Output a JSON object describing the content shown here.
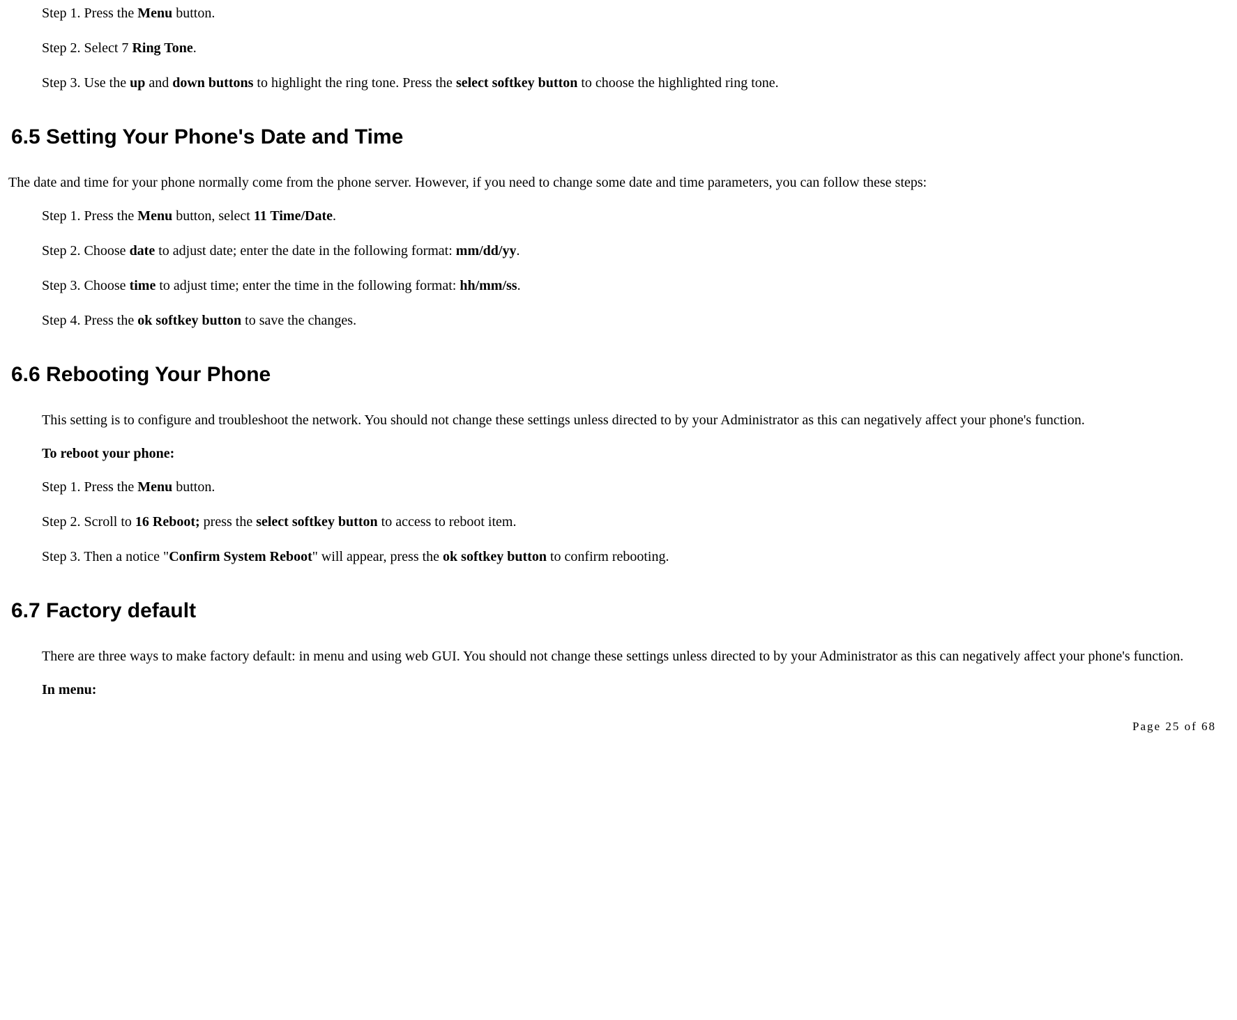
{
  "top_steps": {
    "s1_pre": "Step 1. Press the ",
    "s1_b1": "Menu",
    "s1_post": " button.",
    "s2_pre": "Step 2. Select 7 ",
    "s2_b1": "Ring Tone",
    "s2_post": ".",
    "s3_pre": "Step 3. Use the ",
    "s3_b1": "up",
    "s3_mid1": " and ",
    "s3_b2": "down buttons",
    "s3_mid2": " to highlight the ring tone. Press the ",
    "s3_b3": "select softkey button",
    "s3_post": " to choose the highlighted ring tone."
  },
  "sec65": {
    "heading": "6.5    Setting Your Phone's Date and Time",
    "intro": "The date and time for your phone normally come from the phone server. However, if you need to change some date and time parameters, you can follow these steps:",
    "s1_pre": "Step 1. Press the ",
    "s1_b1": "Menu",
    "s1_mid": " button, select ",
    "s1_b2": "11 Time/Date",
    "s1_post": ".",
    "s2_pre": "Step 2. Choose ",
    "s2_b1": "date",
    "s2_mid": " to adjust date; enter the date in the following format: ",
    "s2_b2": "mm/dd/yy",
    "s2_post": ".",
    "s3_pre": "Step 3. Choose ",
    "s3_b1": "time",
    "s3_mid": " to adjust time; enter the time in the following format: ",
    "s3_b2": "hh/mm/ss",
    "s3_post": ".",
    "s4_pre": "Step 4. Press the ",
    "s4_b1": "ok softkey button",
    "s4_post": " to save the changes."
  },
  "sec66": {
    "heading": "6.6    Rebooting Your Phone",
    "intro": "This setting is to configure and troubleshoot the network. You should not change these settings unless directed to by your Administrator as this can negatively affect your phone's function.",
    "sub": "To reboot your phone:",
    "s1_pre": "Step 1. Press the ",
    "s1_b1": "Menu",
    "s1_post": " button.",
    "s2_pre": "Step 2. Scroll to ",
    "s2_b1": "16 Reboot;",
    "s2_mid": " press the ",
    "s2_b2": "select softkey button",
    "s2_post": " to access to reboot item.",
    "s3_pre": "Step 3. Then a notice \"",
    "s3_b1": "Confirm System Reboot",
    "s3_mid": "\" will appear, press the ",
    "s3_b2": "ok softkey button",
    "s3_post": " to confirm rebooting."
  },
  "sec67": {
    "heading": "6.7    Factory default",
    "intro": "There are three ways to make factory default: in menu and using web GUI. You should not change these settings unless directed to by your Administrator as this can negatively affect your phone's function.",
    "sub": "In menu:"
  },
  "footer": "Page 25 of 68"
}
